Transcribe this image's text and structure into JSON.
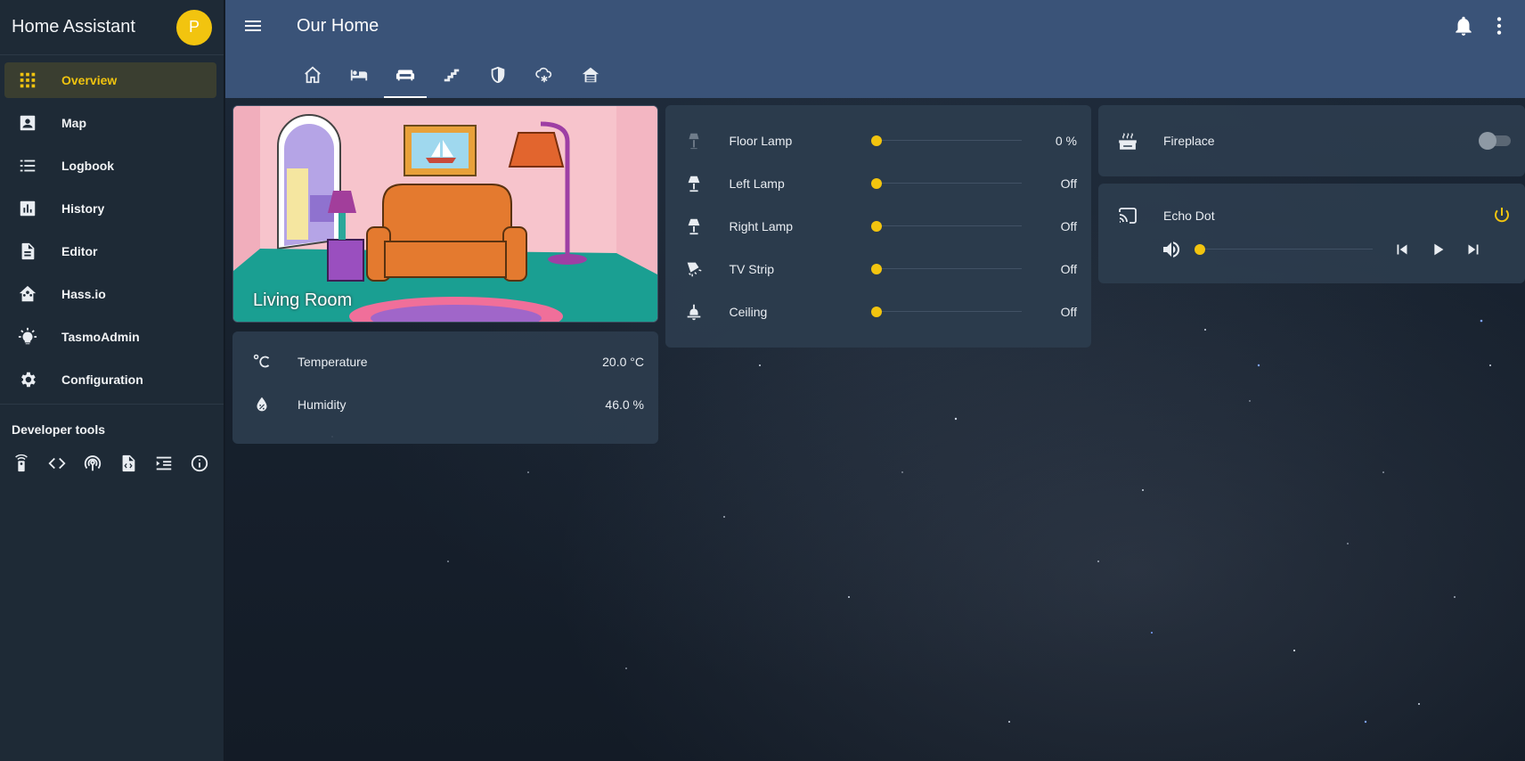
{
  "app": {
    "title": "Home Assistant",
    "avatar_letter": "P"
  },
  "sidebar": {
    "items": [
      {
        "label": "Overview",
        "icon": "apps-grid-icon",
        "active": true
      },
      {
        "label": "Map",
        "icon": "account-box-icon"
      },
      {
        "label": "Logbook",
        "icon": "format-list-bulleted-icon"
      },
      {
        "label": "History",
        "icon": "chart-box-icon"
      },
      {
        "label": "Editor",
        "icon": "file-document-icon"
      },
      {
        "label": "Hass.io",
        "icon": "home-assistant-icon"
      },
      {
        "label": "TasmoAdmin",
        "icon": "lightbulb-on-icon"
      },
      {
        "label": "Configuration",
        "icon": "settings-gear-icon"
      }
    ],
    "developer_tools_title": "Developer tools",
    "developer_tools": [
      "remote-icon",
      "code-tags-icon",
      "radio-tower-icon",
      "file-xml-icon",
      "format-indent-icon",
      "information-outline-icon"
    ]
  },
  "header": {
    "title": "Our Home"
  },
  "tabs": [
    {
      "icon": "home-outline-icon"
    },
    {
      "icon": "bed-icon"
    },
    {
      "icon": "sofa-icon",
      "active": true
    },
    {
      "icon": "stairs-icon"
    },
    {
      "icon": "shield-half-icon"
    },
    {
      "icon": "weather-snowy-icon"
    },
    {
      "icon": "home-garage-icon"
    }
  ],
  "picture_card": {
    "label": "Living Room"
  },
  "sensors": [
    {
      "name": "Temperature",
      "value": "20.0 °C",
      "icon": "thermometer-celsius-icon"
    },
    {
      "name": "Humidity",
      "value": "46.0 %",
      "icon": "water-percent-icon"
    }
  ],
  "lights": [
    {
      "name": "Floor Lamp",
      "value": "0 %",
      "level": 0,
      "icon": "floor-lamp-icon"
    },
    {
      "name": "Left Lamp",
      "value": "Off",
      "level": 0,
      "icon": "lamp-icon"
    },
    {
      "name": "Right Lamp",
      "value": "Off",
      "level": 0,
      "icon": "lamp-icon"
    },
    {
      "name": "TV Strip",
      "value": "Off",
      "level": 0,
      "icon": "led-strip-icon"
    },
    {
      "name": "Ceiling",
      "value": "Off",
      "level": 0,
      "icon": "ceiling-light-icon"
    }
  ],
  "fireplace": {
    "name": "Fireplace",
    "state": "off",
    "icon": "fireplace-icon"
  },
  "media": {
    "name": "Echo Dot",
    "icon": "cast-icon",
    "volume_level": 0,
    "accent": "#f2c40f"
  },
  "colors": {
    "accent": "#f2c40f",
    "header": "#3a5378",
    "sidebar": "#1e2a36",
    "card": "#2c3c4e"
  }
}
